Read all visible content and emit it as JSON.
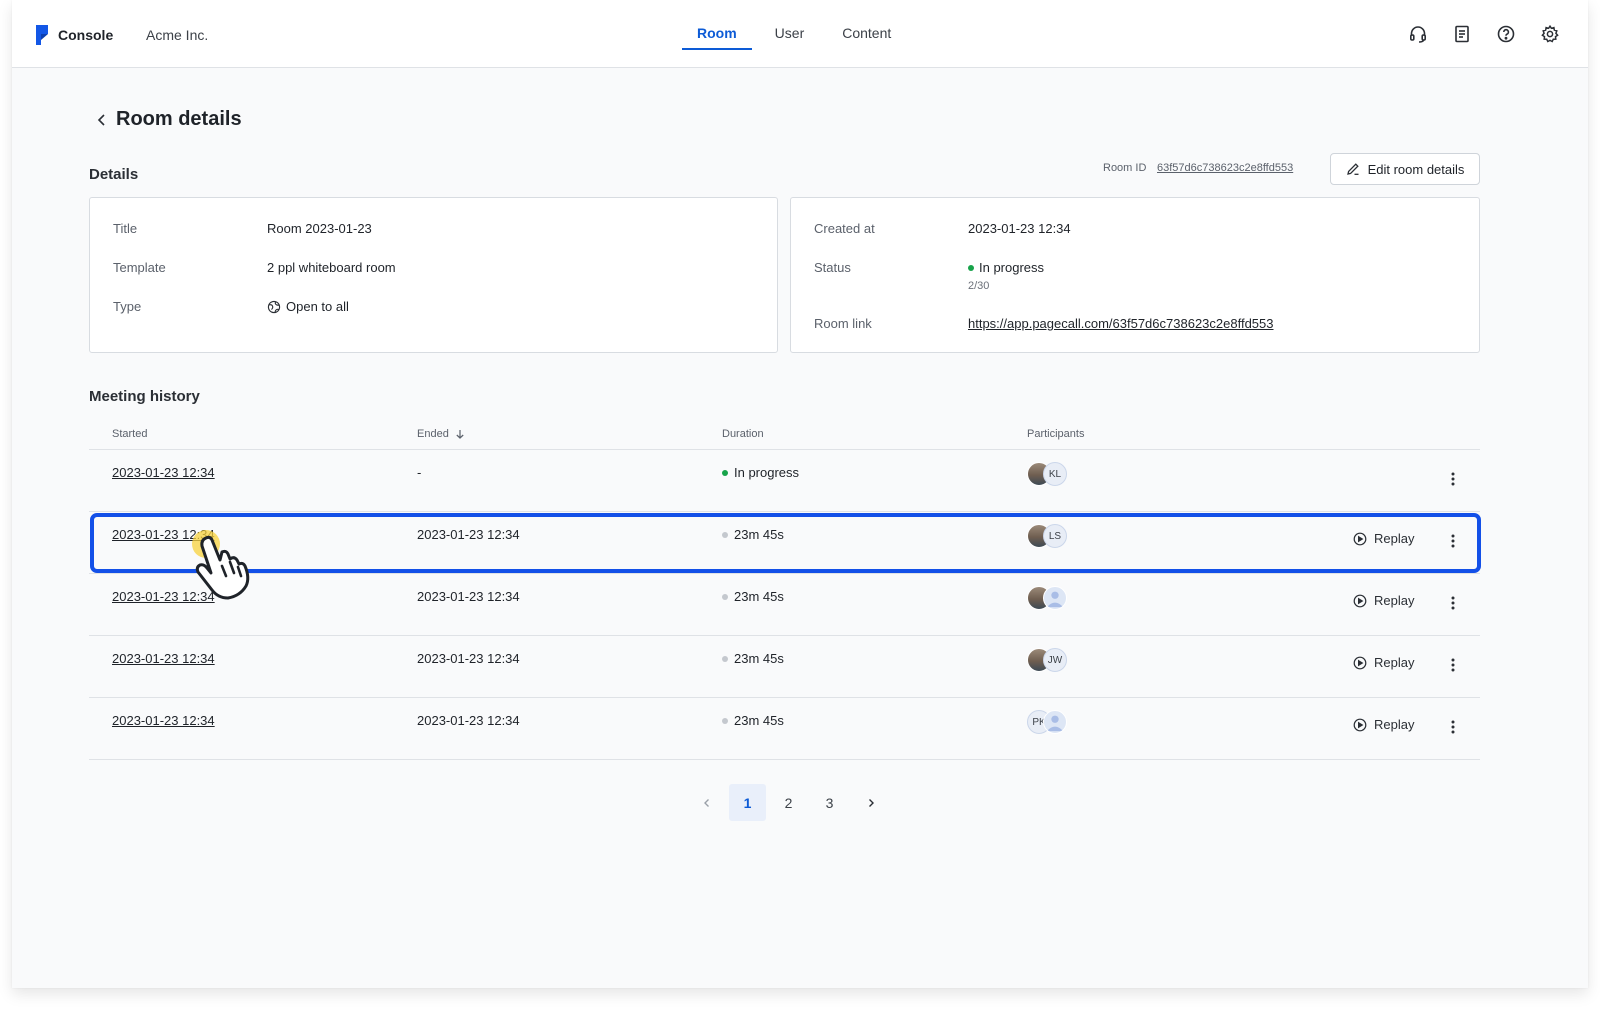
{
  "header": {
    "brand": "Console",
    "org": "Acme Inc.",
    "tabs": [
      {
        "label": "Room",
        "active": true
      },
      {
        "label": "User",
        "active": false
      },
      {
        "label": "Content",
        "active": false
      }
    ],
    "icons": [
      "headset-icon",
      "document-icon",
      "help-icon",
      "settings-icon"
    ]
  },
  "page": {
    "title": "Room details",
    "details_heading": "Details",
    "room_id_label": "Room ID",
    "room_id": "63f57d6c738623c2e8ffd553",
    "edit_button": "Edit room details"
  },
  "details_left": [
    {
      "label": "Title",
      "value": "Room 2023-01-23"
    },
    {
      "label": "Template",
      "value": "2 ppl whiteboard room"
    },
    {
      "label": "Type",
      "value": "Open to all",
      "icon": "globe-icon"
    }
  ],
  "details_right": {
    "created_label": "Created at",
    "created_value": "2023-01-23 12:34",
    "status_label": "Status",
    "status_value": "In progress",
    "status_sub": "2/30",
    "status_color": "#17a34a",
    "link_label": "Room link",
    "link_value": "https://app.pagecall.com/63f57d6c738623c2e8ffd553"
  },
  "history": {
    "heading": "Meeting history",
    "columns": [
      "Started",
      "Ended",
      "Duration",
      "Participants"
    ],
    "sort_icon": "arrow-down-icon",
    "rows": [
      {
        "started": "2023-01-23 12:34",
        "ended": "-",
        "duration": "In progress",
        "status": "active",
        "avatars": [
          {
            "type": "photo"
          },
          {
            "type": "initials",
            "text": "KL"
          }
        ],
        "replay": ""
      },
      {
        "started": "2023-01-23 12:34",
        "ended": "2023-01-23 12:34",
        "duration": "23m 45s",
        "status": "done",
        "avatars": [
          {
            "type": "photo"
          },
          {
            "type": "initials",
            "text": "LS"
          }
        ],
        "replay": "Replay"
      },
      {
        "started": "2023-01-23 12:34",
        "ended": "2023-01-23 12:34",
        "duration": "23m 45s",
        "status": "done",
        "avatars": [
          {
            "type": "photo"
          },
          {
            "type": "generic"
          }
        ],
        "replay": "Replay"
      },
      {
        "started": "2023-01-23 12:34",
        "ended": "2023-01-23 12:34",
        "duration": "23m 45s",
        "status": "done",
        "avatars": [
          {
            "type": "photo"
          },
          {
            "type": "initials",
            "text": "JW"
          }
        ],
        "replay": "Replay"
      },
      {
        "started": "2023-01-23 12:34",
        "ended": "2023-01-23 12:34",
        "duration": "23m 45s",
        "status": "done",
        "avatars": [
          {
            "type": "initials",
            "text": "PK"
          },
          {
            "type": "generic"
          }
        ],
        "replay": "Replay"
      }
    ]
  },
  "pagination": {
    "pages": [
      "1",
      "2",
      "3"
    ],
    "current": "1"
  },
  "colors": {
    "accent": "#0d5bd6",
    "highlight": "#1350e8",
    "in_progress": "#17a34a",
    "done": "#c4c8ce"
  }
}
